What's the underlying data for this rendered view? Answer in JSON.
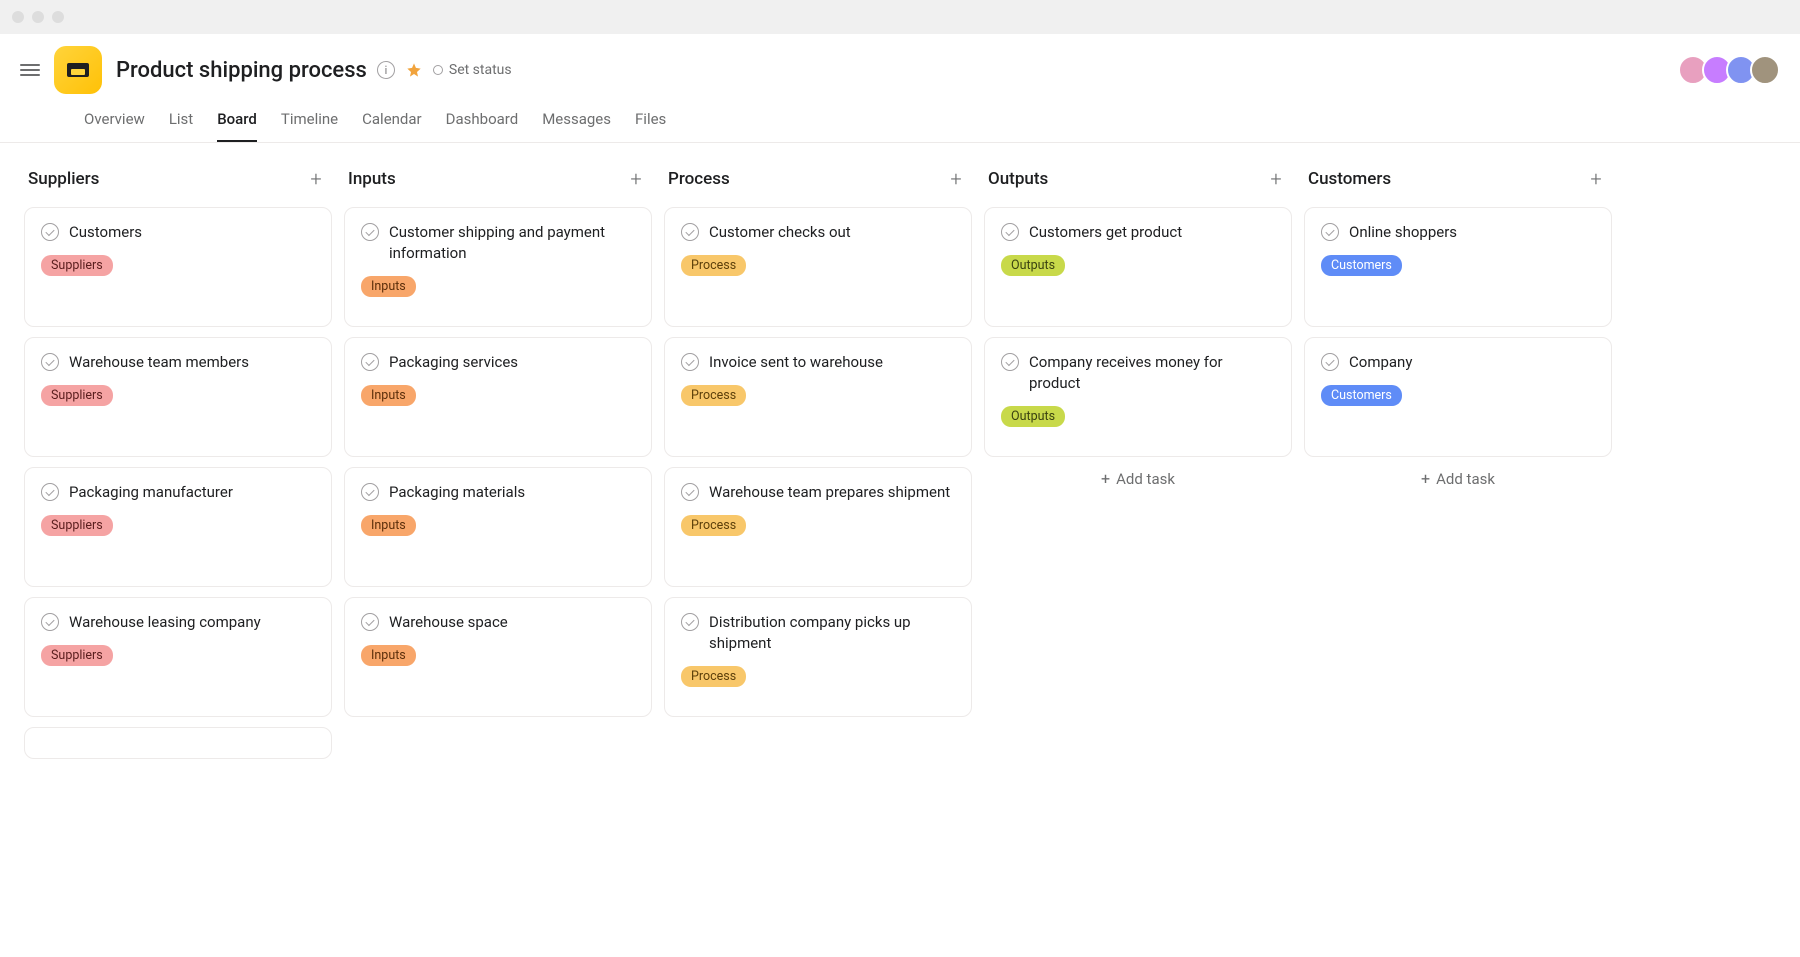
{
  "project": {
    "title": "Product shipping process",
    "set_status": "Set status"
  },
  "tabs": [
    {
      "label": "Overview",
      "active": false
    },
    {
      "label": "List",
      "active": false
    },
    {
      "label": "Board",
      "active": true
    },
    {
      "label": "Timeline",
      "active": false
    },
    {
      "label": "Calendar",
      "active": false
    },
    {
      "label": "Dashboard",
      "active": false
    },
    {
      "label": "Messages",
      "active": false
    },
    {
      "label": "Files",
      "active": false
    }
  ],
  "add_task_label": "Add task",
  "columns": [
    {
      "title": "Suppliers",
      "tag_class": "tag-suppliers",
      "tag_label": "Suppliers",
      "cards": [
        {
          "title": "Customers"
        },
        {
          "title": "Warehouse team members"
        },
        {
          "title": "Packaging manufacturer"
        },
        {
          "title": "Warehouse leasing company"
        }
      ],
      "show_add": false,
      "trailing_empty": true
    },
    {
      "title": "Inputs",
      "tag_class": "tag-inputs",
      "tag_label": "Inputs",
      "cards": [
        {
          "title": "Customer shipping and payment information"
        },
        {
          "title": "Packaging services"
        },
        {
          "title": "Packaging materials"
        },
        {
          "title": "Warehouse space"
        }
      ],
      "show_add": false,
      "trailing_empty": false
    },
    {
      "title": "Process",
      "tag_class": "tag-process",
      "tag_label": "Process",
      "cards": [
        {
          "title": "Customer checks out"
        },
        {
          "title": "Invoice sent to warehouse"
        },
        {
          "title": "Warehouse team prepares shipment"
        },
        {
          "title": "Distribution company picks up shipment"
        }
      ],
      "show_add": false,
      "trailing_empty": false
    },
    {
      "title": "Outputs",
      "tag_class": "tag-outputs",
      "tag_label": "Outputs",
      "cards": [
        {
          "title": "Customers get product"
        },
        {
          "title": "Company receives money for product"
        }
      ],
      "show_add": true,
      "trailing_empty": false
    },
    {
      "title": "Customers",
      "tag_class": "tag-customers",
      "tag_label": "Customers",
      "cards": [
        {
          "title": "Online shoppers"
        },
        {
          "title": "Company"
        }
      ],
      "show_add": true,
      "trailing_empty": false
    }
  ]
}
